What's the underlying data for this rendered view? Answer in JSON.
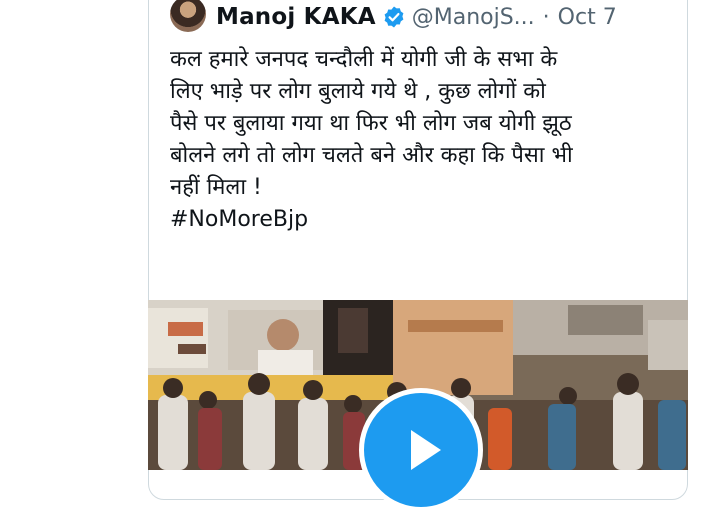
{
  "tweet": {
    "author_name": "Manoj KAKA",
    "handle": "@ManojS...",
    "separator": "·",
    "date": "Oct 7",
    "text_lines": [
      "कल हमारे जनपद चन्दौली में योगी जी के सभा के",
      "लिए भाड़े पर लोग बुलाये गये थे , कुछ लोगों को",
      "पैसे पर बुलाया गया था फिर भी लोग जब योगी झूठ",
      "बोलने लगे तो लोग चलते बने और कहा कि पैसा भी",
      "नहीं मिला !"
    ],
    "hashtag": "#NoMoreBjp"
  },
  "icons": {
    "verified": "verified-badge-icon",
    "play": "play-icon"
  },
  "colors": {
    "verified_blue": "#1d9bf0",
    "play_button": "#1d9bf0",
    "secondary_text": "#536471",
    "border": "#cfd9de"
  }
}
